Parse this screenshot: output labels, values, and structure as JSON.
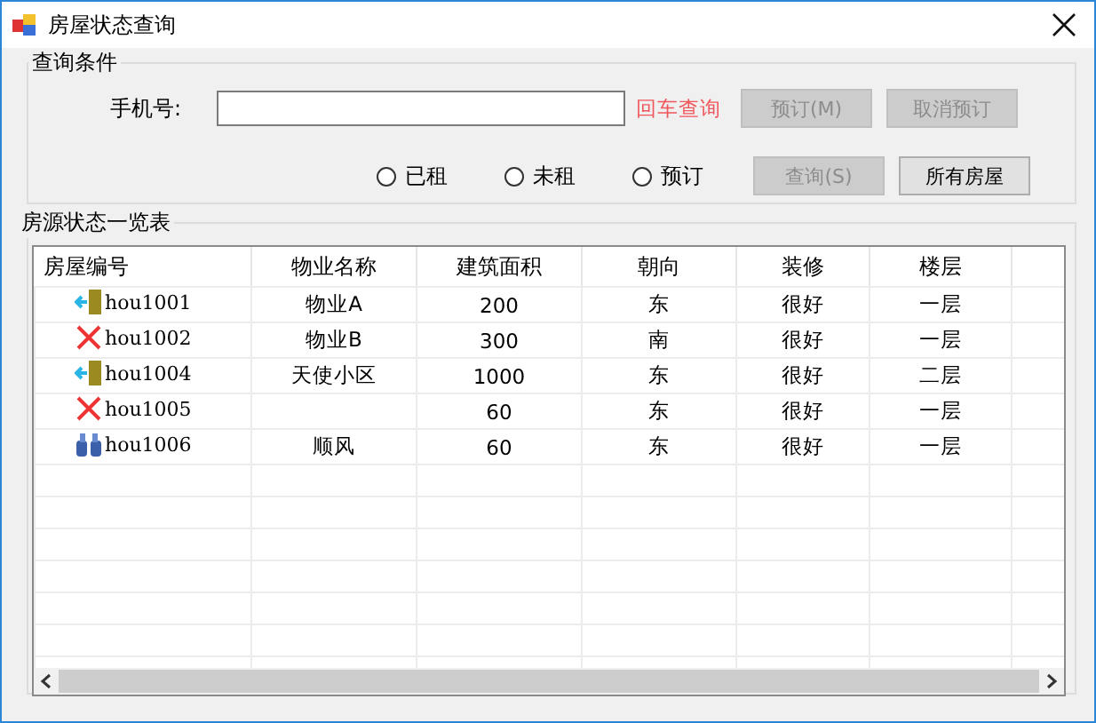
{
  "window": {
    "title": "房屋状态查询"
  },
  "query_group": {
    "title": "查询条件",
    "phone_label": "手机号:",
    "hint": "回车查询",
    "buttons": [
      {
        "label": "预订(M)",
        "disabled": true
      },
      {
        "label": "取消预订",
        "disabled": true
      }
    ],
    "radios": [
      {
        "label": "已租",
        "selected": false
      },
      {
        "label": "未租",
        "selected": false
      },
      {
        "label": "预订",
        "selected": false
      }
    ],
    "buttons_2": [
      {
        "label": "查询(S)",
        "disabled": true
      },
      {
        "label": "所有房屋",
        "disabled": false
      }
    ]
  },
  "list_group": {
    "title": "房源状态一览表",
    "columns": [
      "房屋编号",
      "物业名称",
      "建筑面积",
      "朝向",
      "装修",
      "楼层"
    ],
    "rows": [
      {
        "kind": "door",
        "cells": [
          "hou1001",
          "物业A",
          "200",
          "东",
          "很好",
          "一层"
        ]
      },
      {
        "kind": "cross",
        "cells": [
          "hou1002",
          "物业B",
          "300",
          "南",
          "很好",
          "一层"
        ]
      },
      {
        "kind": "door",
        "cells": [
          "hou1004",
          "天使小区",
          "1000",
          "东",
          "很好",
          "二层"
        ]
      },
      {
        "kind": "cross",
        "cells": [
          "hou1005",
          "",
          "60",
          "东",
          "很好",
          "一层"
        ]
      },
      {
        "kind": "binoculars",
        "cells": [
          "hou1006",
          "顺风",
          "60",
          "东",
          "很好",
          "一层"
        ]
      }
    ]
  }
}
